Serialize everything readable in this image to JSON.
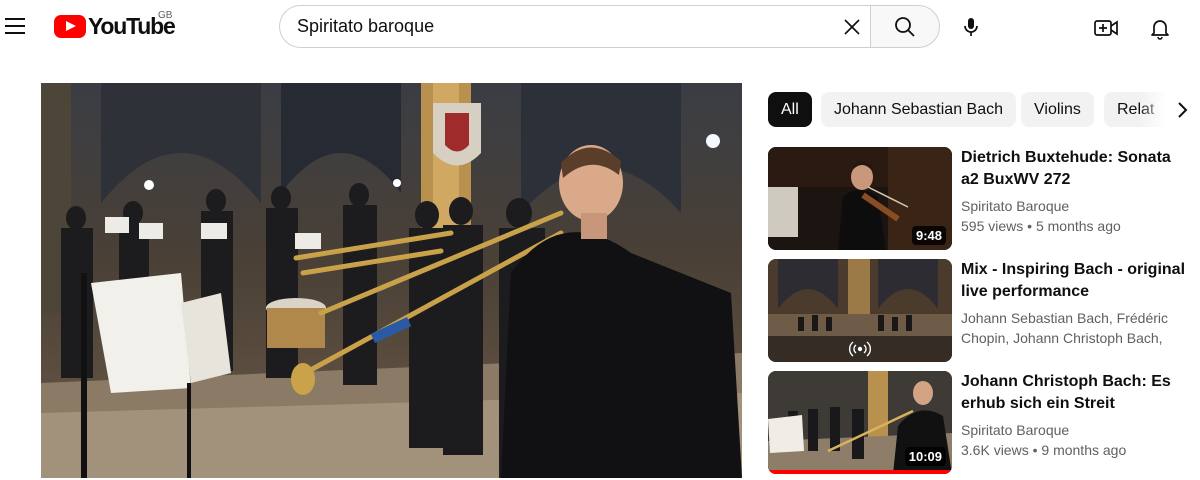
{
  "header": {
    "logo_text": "YouTube",
    "country_code": "GB",
    "search_query": "Spiritato baroque",
    "icons": [
      "menu-icon",
      "youtube-play-icon",
      "close-icon",
      "search-icon",
      "microphone-icon",
      "create-video-icon",
      "bell-icon"
    ]
  },
  "chips": [
    {
      "label": "All",
      "active": true
    },
    {
      "label": "Johann Sebastian Bach",
      "active": false
    },
    {
      "label": "Violins",
      "active": false
    },
    {
      "label": "Relat",
      "active": false
    }
  ],
  "recommendations": [
    {
      "title": "Dietrich Buxtehude: Sonata a2 BuxWV 272",
      "channel": "Spiritato Baroque",
      "views": "595 views",
      "age": "5 months ago",
      "duration": "9:48"
    },
    {
      "title": "Mix - Inspiring Bach - original live performance",
      "channel": "Johann Sebastian Bach, Frédéric Chopin, Johann Christoph Bach, and...",
      "badge_icon": "live-broadcast-icon"
    },
    {
      "title": "Johann Christoph Bach: Es erhub sich ein Streit",
      "channel": "Spiritato Baroque",
      "views": "3.6K views",
      "age": "9 months ago",
      "duration": "10:09",
      "watched_progress": 1.0
    }
  ],
  "colors": {
    "brand_red": "#ff0000",
    "chip_active_bg": "#0f0f0f",
    "chip_bg": "#f2f2f2",
    "secondary_text": "#606060"
  }
}
